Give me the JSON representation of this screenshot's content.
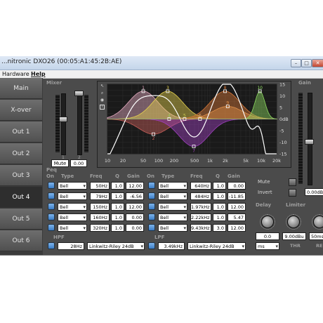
{
  "window": {
    "title": "...nitronic DXO26 (00:05:A1:45:2B:AE)"
  },
  "titlebar_buttons": {
    "minimize": "–",
    "maximize": "□",
    "close": "✕"
  },
  "menu": {
    "hardware": "Hardware",
    "help": "Help"
  },
  "sidebar": {
    "items": [
      "Main",
      "X-over",
      "Out 1",
      "Out 2",
      "Out 3",
      "Out 4",
      "Out 5",
      "Out 6"
    ],
    "active": "Out 4"
  },
  "mixer": {
    "label": "Mixer",
    "mute": "Mute",
    "level": "0.00",
    "channels": [
      "1",
      "2"
    ]
  },
  "gain": {
    "label": "Gain",
    "value": "0.00dB"
  },
  "peq": {
    "label": "Peq",
    "headers": {
      "on": "On",
      "type": "Type",
      "freq": "Freq",
      "q": "Q",
      "gain": "Gain"
    },
    "bands": [
      {
        "type": "Bell",
        "freq": "50Hz",
        "q": "1.0",
        "gain": "12.00"
      },
      {
        "type": "Bell",
        "freq": "79Hz",
        "q": "1.0",
        "gain": "-6.56"
      },
      {
        "type": "Bell",
        "freq": "150Hz",
        "q": "1.0",
        "gain": "12.00"
      },
      {
        "type": "Bell",
        "freq": "160Hz",
        "q": "1.0",
        "gain": "0.00"
      },
      {
        "type": "Bell",
        "freq": "320Hz",
        "q": "1.0",
        "gain": "0.00"
      },
      {
        "type": "Bell",
        "freq": "640Hz",
        "q": "1.0",
        "gain": "0.00"
      },
      {
        "type": "Bell",
        "freq": "484Hz",
        "q": "1.0",
        "gain": "-11.85"
      },
      {
        "type": "Bell",
        "freq": "1.97kHz",
        "q": "1.0",
        "gain": "12.00"
      },
      {
        "type": "Bell",
        "freq": "2.22kHz",
        "q": "1.0",
        "gain": "5.47"
      },
      {
        "type": "Bell",
        "freq": "9.43kHz",
        "q": "3.0",
        "gain": "12.00"
      }
    ]
  },
  "hpf": {
    "label": "HPF",
    "freq": "28Hz",
    "type": "Linkwitz-Riley 24dB"
  },
  "lpf": {
    "label": "LPF",
    "freq": "3.49kHz",
    "type": "Linkwitz-Riley 24dB"
  },
  "controls": {
    "mute": "Mute",
    "invert": "Invert"
  },
  "delay": {
    "label": "Delay",
    "value": "0.0",
    "unit": "ms"
  },
  "limiter": {
    "label": "Limiter",
    "thr_value": "9.00dBu",
    "thr_label": "THR",
    "rel_value": "50ms",
    "rel_label": "REL"
  },
  "graph": {
    "x_ticks": [
      "10",
      "20",
      "50",
      "100",
      "200",
      "500",
      "1k",
      "2k",
      "5k",
      "10k",
      "20k"
    ],
    "y_ticks": [
      "15",
      "10",
      "5",
      "0dB",
      "-5",
      "-10",
      "-15"
    ],
    "markers": [
      "1",
      "2",
      "3",
      "4",
      "5",
      "6",
      "7",
      "8",
      "9",
      "10"
    ],
    "tool_icons": [
      "cursor-icon",
      "zoom-icon",
      "eye-icon",
      "text-icon"
    ],
    "colors": {
      "response": "#ffffff",
      "grid": "#2c2c2c"
    }
  }
}
